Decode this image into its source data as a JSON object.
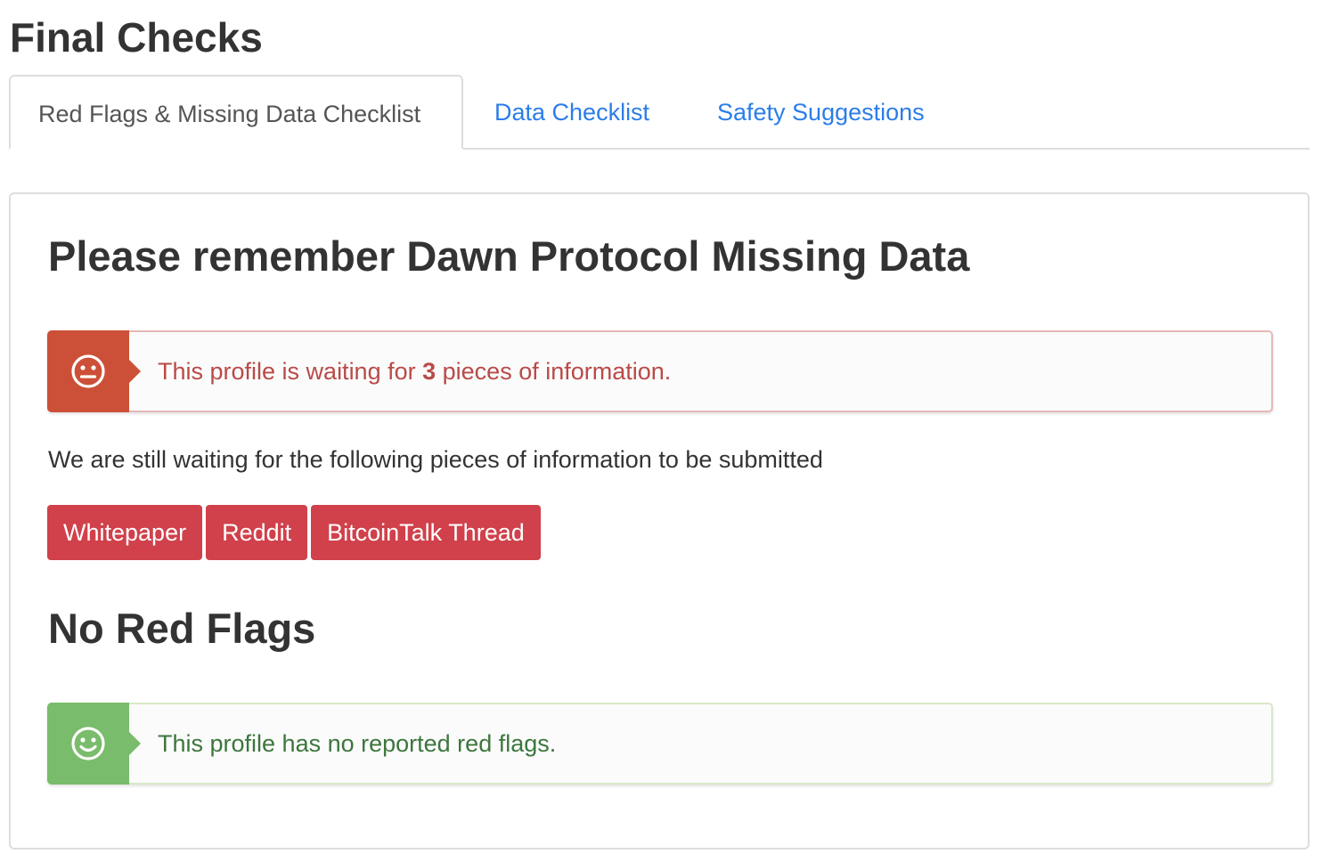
{
  "page": {
    "title": "Final Checks"
  },
  "tabs": [
    {
      "label": "Red Flags & Missing Data Checklist",
      "active": true
    },
    {
      "label": "Data Checklist",
      "active": false
    },
    {
      "label": "Safety Suggestions",
      "active": false
    }
  ],
  "missing_data": {
    "heading": "Please remember Dawn Protocol Missing Data",
    "alert": {
      "icon": "neutral-face-icon",
      "prefix": "This profile is waiting for ",
      "count": "3",
      "suffix": " pieces of information."
    },
    "waiting_text": "We are still waiting for the following pieces of information to be submitted",
    "items": [
      "Whitepaper",
      "Reddit",
      "BitcoinTalk Thread"
    ]
  },
  "red_flags": {
    "heading": "No Red Flags",
    "alert": {
      "icon": "smile-face-icon",
      "text": "This profile has no reported red flags."
    }
  },
  "colors": {
    "danger_icon_bg": "#cc5037",
    "danger_text": "#b94a48",
    "success_icon_bg": "#79bc6b",
    "success_text": "#3c763d",
    "missing_button_bg": "#d0414b",
    "tab_link": "#2b7de9"
  }
}
